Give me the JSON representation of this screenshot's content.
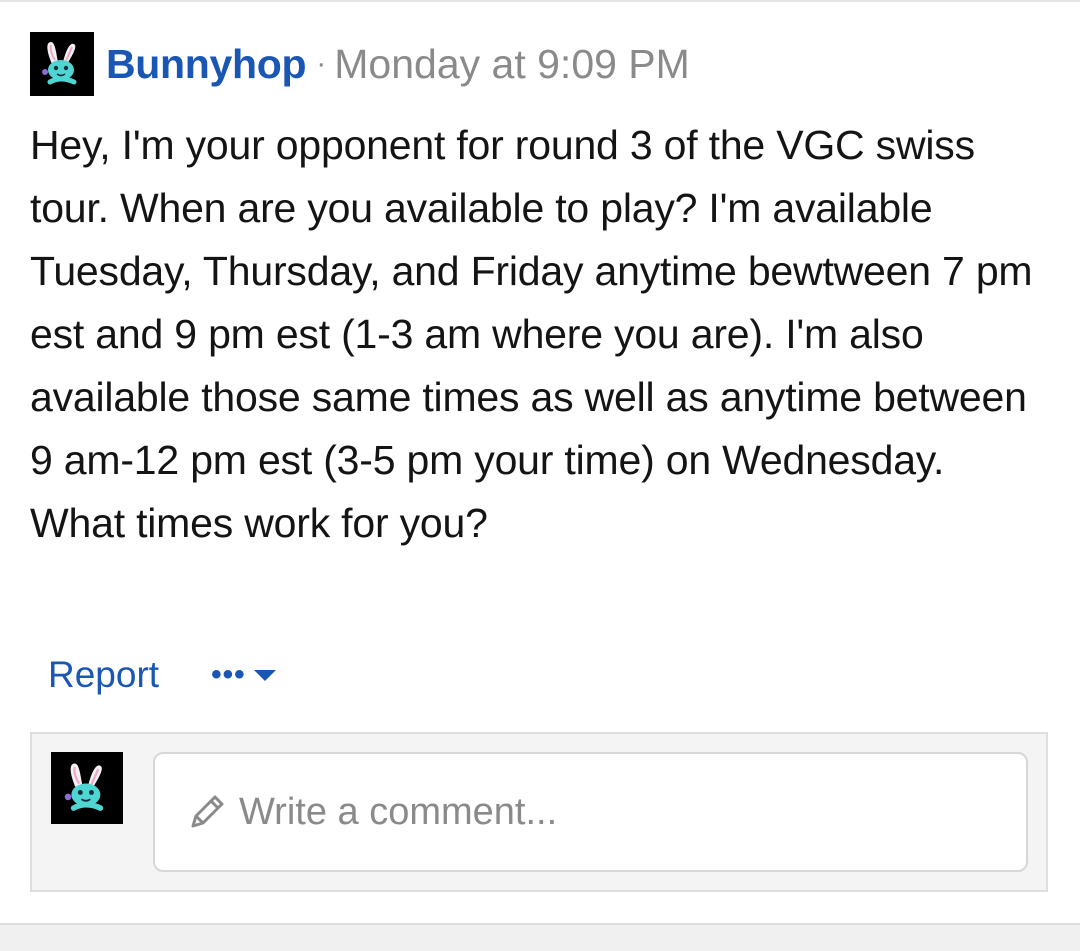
{
  "post": {
    "author": "Bunnyhop",
    "separator": "·",
    "timestamp": "Monday at 9:09 PM",
    "avatar_icon": "bunny-avatar-icon",
    "message": "Hey, I'm your opponent for round 3 of the VGC swiss tour. When are you available to play? I'm available Tuesday, Thursday, and Friday anytime bewtween 7 pm est and 9 pm est (1-3 am where you are). I'm also available those same times as well as anytime between 9 am-12 pm est (3-5 pm your time) on Wednesday. What times work for you?"
  },
  "actions": {
    "report_label": "Report",
    "more_icon": "more-options-icon"
  },
  "comment": {
    "placeholder": "Write a comment...",
    "pencil_icon": "pencil-icon"
  },
  "colors": {
    "link": "#1a56b4",
    "muted": "#8a8a8a",
    "text": "#141414"
  }
}
